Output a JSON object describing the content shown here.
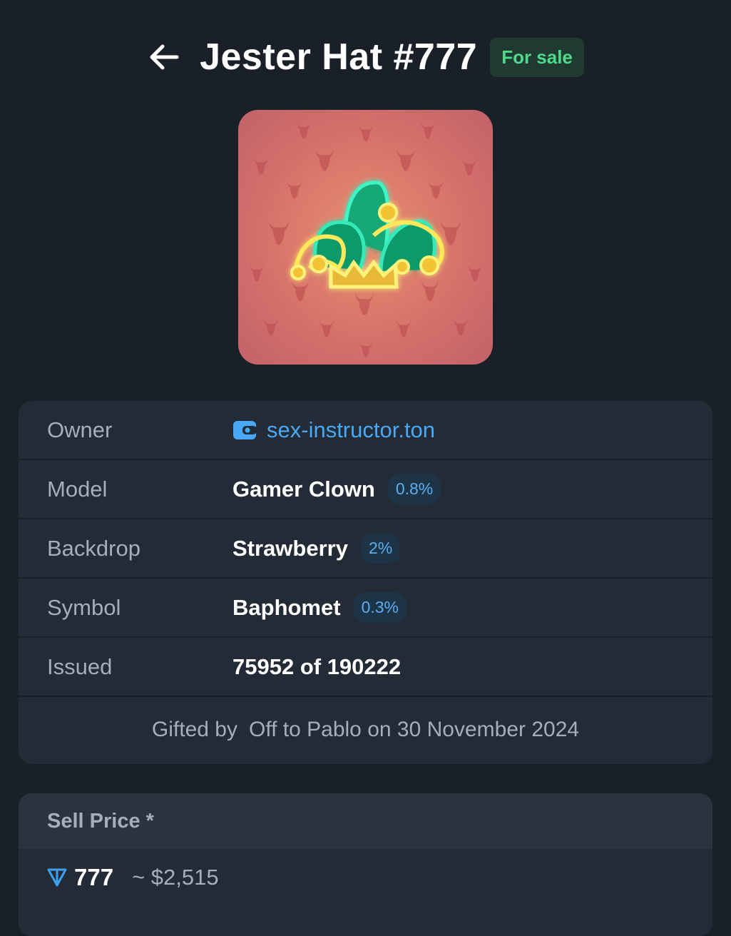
{
  "header": {
    "title": "Jester Hat #777",
    "status_badge": "For sale",
    "back_icon": "arrow-left-icon"
  },
  "gift": {
    "image": "jester-hat-neon-icon",
    "backdrop_color": "#d4706a",
    "pattern_symbol": "goat-head-icon"
  },
  "details": {
    "owner": {
      "label": "Owner",
      "value": "sex-instructor.ton",
      "icon": "wallet-icon"
    },
    "model": {
      "label": "Model",
      "value": "Gamer Clown",
      "rarity": "0.8%"
    },
    "backdrop": {
      "label": "Backdrop",
      "value": "Strawberry",
      "rarity": "2%"
    },
    "symbol": {
      "label": "Symbol",
      "value": "Baphomet",
      "rarity": "0.3%"
    },
    "issued": {
      "label": "Issued",
      "value": "75952 of 190222"
    },
    "gifted": {
      "prefix": "Gifted by",
      "text": "Off to Pablo on 30 November 2024"
    }
  },
  "price": {
    "label": "Sell Price *",
    "currency_icon": "ton-icon",
    "amount": "777",
    "usd": "~ $2,515"
  },
  "colors": {
    "background": "#1a2027",
    "card": "#232c36",
    "accent_blue": "#49a8f5",
    "badge_green": "#4fd98a"
  }
}
